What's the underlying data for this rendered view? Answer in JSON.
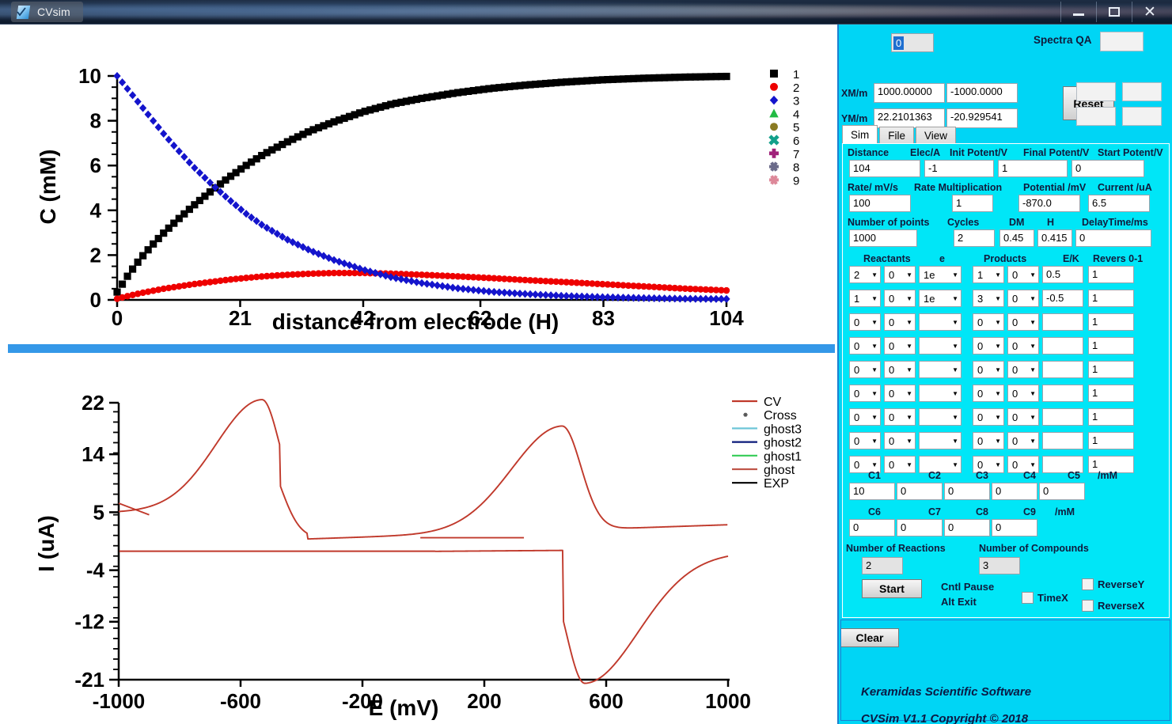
{
  "window": {
    "title": "CVsim",
    "icon": "document-chart-icon",
    "minimize_label": "Minimize",
    "maximize_label": "Maximize",
    "close_label": "Close"
  },
  "panel": {
    "index_value": "0",
    "spectra_qa_label": "Spectra QA",
    "spectra_qa_value": "",
    "xm_label": "XM/m",
    "xm_value": "1000.00000",
    "xm_value2": "-1000.0000",
    "ym_label": "YM/m",
    "ym_value": "22.2101363",
    "ym_value2": "-20.929541",
    "reset_label": "Reset",
    "mini_fields": [
      "",
      "",
      "",
      ""
    ],
    "tabs": [
      {
        "label": "Sim",
        "active": true
      },
      {
        "label": "File",
        "active": false
      },
      {
        "label": "View",
        "active": false
      }
    ],
    "row1": {
      "labels": [
        "Distance",
        "Elec/A",
        "Init Potent/V",
        "Final Potent/V",
        "Start Potent/V"
      ],
      "values": [
        "104",
        "-1",
        "1",
        "0"
      ]
    },
    "row2": {
      "labels": [
        "Rate/ mV/s",
        "Rate Multiplication",
        "Potential /mV",
        "Current /uA"
      ],
      "values": [
        "100",
        "1",
        "-870.0",
        "6.5"
      ]
    },
    "row3": {
      "labels": [
        "Number of points",
        "Cycles",
        "DM",
        "H",
        "DelayTime/ms"
      ],
      "values": [
        "1000",
        "2",
        "0.45",
        "0.415",
        "0"
      ]
    },
    "grid_headers": [
      "Reactants",
      "e",
      "Products",
      "E/K",
      "Revers 0-1"
    ],
    "grid_rows": [
      {
        "r1": "2",
        "r2": "0",
        "e": "1e",
        "p1": "1",
        "p2": "0",
        "ek": "0.5",
        "rev": "1"
      },
      {
        "r1": "1",
        "r2": "0",
        "e": "1e",
        "p1": "3",
        "p2": "0",
        "ek": "-0.5",
        "rev": "1"
      },
      {
        "r1": "0",
        "r2": "0",
        "e": "",
        "p1": "0",
        "p2": "0",
        "ek": "",
        "rev": "1"
      },
      {
        "r1": "0",
        "r2": "0",
        "e": "",
        "p1": "0",
        "p2": "0",
        "ek": "",
        "rev": "1"
      },
      {
        "r1": "0",
        "r2": "0",
        "e": "",
        "p1": "0",
        "p2": "0",
        "ek": "",
        "rev": "1"
      },
      {
        "r1": "0",
        "r2": "0",
        "e": "",
        "p1": "0",
        "p2": "0",
        "ek": "",
        "rev": "1"
      },
      {
        "r1": "0",
        "r2": "0",
        "e": "",
        "p1": "0",
        "p2": "0",
        "ek": "",
        "rev": "1"
      },
      {
        "r1": "0",
        "r2": "0",
        "e": "",
        "p1": "0",
        "p2": "0",
        "ek": "",
        "rev": "1"
      },
      {
        "r1": "0",
        "r2": "0",
        "e": "",
        "p1": "0",
        "p2": "0",
        "ek": "",
        "rev": "1"
      }
    ],
    "conc_row1": {
      "labels": [
        "C1",
        "C2",
        "C3",
        "C4",
        "C5",
        "/mM"
      ],
      "values": [
        "10",
        "0",
        "0",
        "0",
        "0"
      ]
    },
    "conc_row2": {
      "labels": [
        "C6",
        "C7",
        "C8",
        "C9",
        "/mM"
      ],
      "values": [
        "0",
        "0",
        "0",
        "0"
      ]
    },
    "num_reactions_label": "Number of Reactions",
    "num_reactions_value": "2",
    "num_compounds_label": "Number of Compounds",
    "num_compounds_value": "3",
    "start_label": "Start",
    "hint_line1": "Cntl Pause",
    "hint_line2": "Alt Exit",
    "timex_label": "TimeX",
    "reversey_label": "ReverseY",
    "reversex_label": "ReverseX",
    "clear_label": "Clear",
    "credit_line1": "Keramidas Scientific Software",
    "credit_line2": "CVSim V1.1 Copyright ©  2018"
  },
  "chart_data": [
    {
      "type": "scatter",
      "id": "concentration-profile",
      "title": "",
      "xlabel": "distance from electrode (H)",
      "ylabel": "C (mM)",
      "xlim": [
        0,
        104
      ],
      "ylim": [
        0,
        10
      ],
      "xticks": [
        0,
        21,
        42,
        62,
        83,
        104
      ],
      "yticks": [
        0,
        2,
        4,
        6,
        8,
        10
      ],
      "minor_ticks": true,
      "grid": false,
      "legend_position": "right",
      "legend": [
        "1",
        "2",
        "3",
        "4",
        "5",
        "6",
        "7",
        "8",
        "9"
      ],
      "legend_markers": [
        {
          "label": "1",
          "marker": "square",
          "color": "#000000"
        },
        {
          "label": "2",
          "marker": "circle",
          "color": "#ee0000"
        },
        {
          "label": "3",
          "marker": "diamond",
          "color": "#1414cc"
        },
        {
          "label": "4",
          "marker": "triangle",
          "color": "#22bb44"
        },
        {
          "label": "5",
          "marker": "circle",
          "color": "#8a7a22"
        },
        {
          "label": "6",
          "marker": "cross",
          "color": "#12a08a"
        },
        {
          "label": "7",
          "marker": "plus",
          "color": "#a0227a"
        },
        {
          "label": "8",
          "marker": "star",
          "color": "#6b6b8a"
        },
        {
          "label": "9",
          "marker": "star",
          "color": "#dd8899"
        }
      ],
      "series": [
        {
          "name": "1",
          "marker": "square",
          "color": "#000000",
          "x": [
            0,
            2,
            4,
            6,
            8,
            10,
            13,
            16,
            19,
            22,
            25,
            29,
            33,
            37,
            42,
            47,
            52,
            58,
            64,
            70,
            76,
            83,
            90,
            97,
            104
          ],
          "y": [
            0.35,
            1.15,
            1.85,
            2.45,
            3.0,
            3.5,
            4.2,
            4.85,
            5.45,
            6.0,
            6.5,
            7.05,
            7.55,
            7.95,
            8.4,
            8.75,
            9.0,
            9.25,
            9.45,
            9.6,
            9.72,
            9.83,
            9.9,
            9.95,
            9.98
          ]
        },
        {
          "name": "2",
          "marker": "circle",
          "color": "#ee0000",
          "x": [
            0,
            2,
            4,
            6,
            8,
            10,
            13,
            16,
            19,
            22,
            25,
            29,
            33,
            37,
            42,
            47,
            52,
            58,
            64,
            70,
            76,
            83,
            90,
            97,
            104
          ],
          "y": [
            0.05,
            0.18,
            0.3,
            0.4,
            0.5,
            0.58,
            0.7,
            0.8,
            0.9,
            0.98,
            1.05,
            1.12,
            1.17,
            1.2,
            1.2,
            1.17,
            1.12,
            1.05,
            0.97,
            0.88,
            0.8,
            0.7,
            0.6,
            0.5,
            0.42
          ]
        },
        {
          "name": "3",
          "marker": "diamond",
          "color": "#1414cc",
          "x": [
            0,
            2,
            4,
            6,
            8,
            10,
            13,
            16,
            19,
            22,
            25,
            29,
            33,
            37,
            42,
            47,
            52,
            58,
            64,
            70,
            76,
            83,
            90,
            97,
            104
          ],
          "y": [
            10.0,
            9.35,
            8.7,
            8.05,
            7.4,
            6.8,
            5.95,
            5.2,
            4.5,
            3.85,
            3.3,
            2.7,
            2.2,
            1.78,
            1.35,
            1.0,
            0.75,
            0.52,
            0.36,
            0.26,
            0.18,
            0.12,
            0.08,
            0.05,
            0.04
          ]
        }
      ]
    },
    {
      "type": "line",
      "id": "cyclic-voltammogram",
      "title": "",
      "xlabel": "E (mV)",
      "ylabel": "I (uA)",
      "xlim": [
        -1000,
        1000
      ],
      "ylim": [
        -21,
        22
      ],
      "xticks": [
        -1000,
        -600,
        -200,
        200,
        600,
        1000
      ],
      "yticks": [
        22,
        14,
        5,
        -4,
        -12,
        -21
      ],
      "minor_ticks": true,
      "grid": false,
      "legend_position": "right",
      "legend": [
        {
          "label": "CV",
          "color": "#c0392b",
          "type": "line"
        },
        {
          "label": "Cross",
          "color": "#555555",
          "type": "marker"
        },
        {
          "label": "ghost3",
          "color": "#6ec6d8",
          "type": "line"
        },
        {
          "label": "ghost2",
          "color": "#0b1a7a",
          "type": "line"
        },
        {
          "label": "ghost1",
          "color": "#33cc55",
          "type": "line"
        },
        {
          "label": "ghost",
          "color": "#c0564a",
          "type": "line"
        },
        {
          "label": "EXP",
          "color": "#000000",
          "type": "line"
        }
      ],
      "peaks": {
        "anodic_forward_peak": {
          "E": -530,
          "I": 21.5
        },
        "cathodic_reverse_peak": {
          "E": 530,
          "I": -20.5
        },
        "second_anodic_peak": {
          "E": 455,
          "I": 16.5
        }
      }
    }
  ]
}
